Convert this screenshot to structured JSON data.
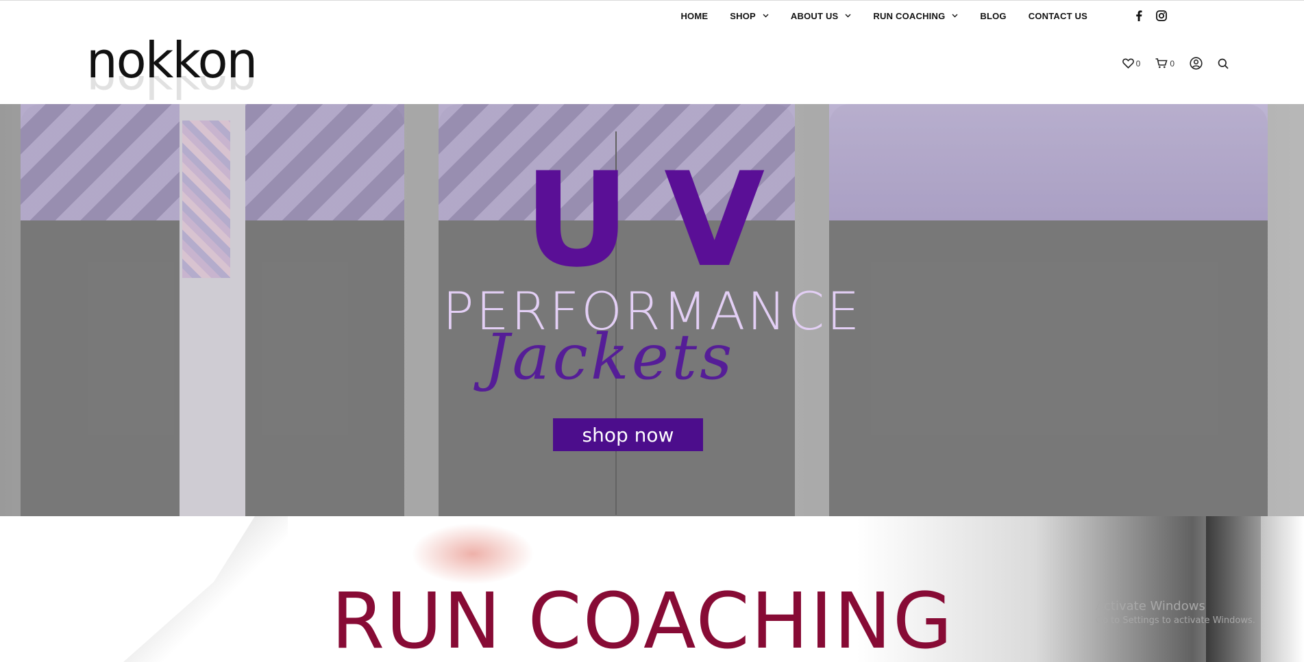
{
  "header": {
    "logo_text": "nokkon",
    "nav": [
      {
        "label": "HOME",
        "has_dropdown": false
      },
      {
        "label": "SHOP",
        "has_dropdown": true
      },
      {
        "label": "ABOUT US",
        "has_dropdown": true
      },
      {
        "label": "RUN COACHING",
        "has_dropdown": true
      },
      {
        "label": "BLOG",
        "has_dropdown": false
      },
      {
        "label": "CONTACT US",
        "has_dropdown": false
      }
    ],
    "social": [
      "facebook-icon",
      "instagram-icon"
    ],
    "utility": {
      "wishlist_count": "0",
      "cart_count": "0"
    }
  },
  "hero": {
    "title_uv": "UV",
    "title_performance": "PERFORMANCE",
    "title_jackets": "Jackets",
    "cta_label": "shop now",
    "colors": {
      "uv": "#5a0f96",
      "performance": "#e3cff5",
      "jackets": "#551d97",
      "cta_bg": "#4c0d8c"
    }
  },
  "section_coaching": {
    "title": "RUN COACHING",
    "color": "#870b35"
  },
  "watermark": {
    "line1": "Activate Windows",
    "line2": "Go to Settings to activate Windows."
  }
}
